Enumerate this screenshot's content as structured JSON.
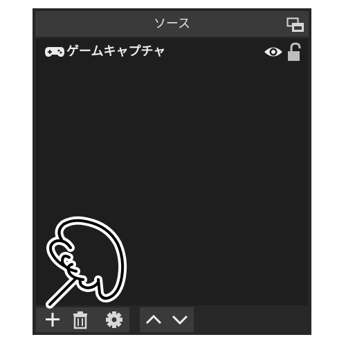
{
  "dock": {
    "title": "ソース",
    "undock_icon": "undock-icon"
  },
  "sources": [
    {
      "name": "ゲームキャプチャ",
      "type_icon": "gamepad-icon",
      "visible": true,
      "locked": false
    }
  ],
  "toolbar": {
    "buttons": [
      {
        "name": "add-source-button",
        "icon": "plus-icon"
      },
      {
        "name": "remove-source-button",
        "icon": "trash-icon"
      },
      {
        "name": "source-properties-button",
        "icon": "gear-icon"
      },
      {
        "name": "move-source-up-button",
        "icon": "chevron-up-icon"
      },
      {
        "name": "move-source-down-button",
        "icon": "chevron-down-icon"
      }
    ]
  },
  "overlay": {
    "icon": "pointing-hand-icon"
  },
  "colors": {
    "panel_bg": "#272727",
    "header_bg": "#3a3a3a",
    "list_bg": "#1e1e1e",
    "text": "#ececec",
    "icon": "#d8d8d8"
  }
}
